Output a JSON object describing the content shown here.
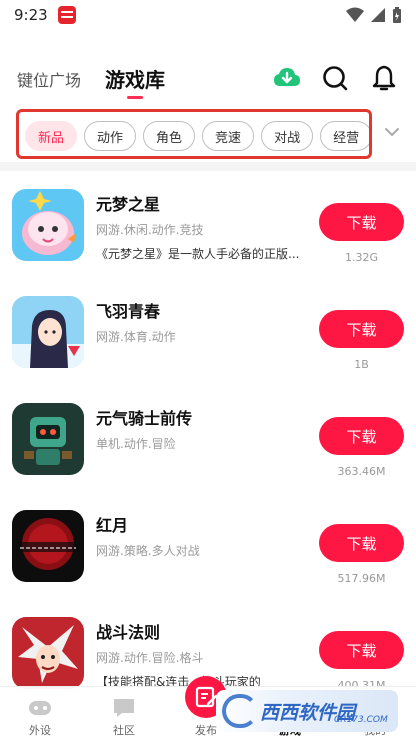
{
  "status_bar": {
    "time": "9:23"
  },
  "top_nav": {
    "tabs": [
      {
        "label": "键位广场"
      },
      {
        "label": "游戏库"
      }
    ]
  },
  "categories": {
    "chips": [
      {
        "label": "新品"
      },
      {
        "label": "动作"
      },
      {
        "label": "角色"
      },
      {
        "label": "竞速"
      },
      {
        "label": "对战"
      },
      {
        "label": "经营"
      }
    ]
  },
  "games": [
    {
      "title": "元梦之星",
      "tags": "网游.休闲.动作.竞技",
      "desc": "《元梦之星》是一款人手必备的正版...",
      "button": "下载",
      "size": "1.32G",
      "icon_name": "yuanmeng-star-icon"
    },
    {
      "title": "飞羽青春",
      "tags": "网游.体育.动作",
      "desc": "",
      "button": "下载",
      "size": "1B",
      "icon_name": "feiyu-youth-icon"
    },
    {
      "title": "元气骑士前传",
      "tags": "单机.动作.冒险",
      "desc": "",
      "button": "下载",
      "size": "363.46M",
      "icon_name": "soul-knight-icon"
    },
    {
      "title": "红月",
      "tags": "网游.策略.多人对战",
      "desc": "",
      "button": "下载",
      "size": "517.96M",
      "icon_name": "redmoon-icon"
    },
    {
      "title": "战斗法则",
      "tags": "网游.动作.冒险.格斗",
      "desc": "【技能搭配&连击...格斗玩家的",
      "button": "下载",
      "size": "400.31M",
      "icon_name": "battle-rules-icon"
    }
  ],
  "bottom_tabs": [
    {
      "label": "外设"
    },
    {
      "label": "社区"
    },
    {
      "label": "发布"
    },
    {
      "label": "游戏"
    },
    {
      "label": "我的"
    }
  ],
  "watermark": {
    "brand": "西西软件园",
    "site": "CR173.COM"
  },
  "colors": {
    "accent": "#ff1744",
    "highlight_frame": "#e0382e",
    "chip_active_bg": "#fde5ea"
  },
  "icons": [
    "cloud-download-icon",
    "search-icon",
    "bell-icon",
    "chevron-down-icon",
    "wifi-icon",
    "signal-icon",
    "battery-icon",
    "gamepad-icon",
    "community-icon",
    "publish-icon",
    "game-icon",
    "profile-icon"
  ]
}
